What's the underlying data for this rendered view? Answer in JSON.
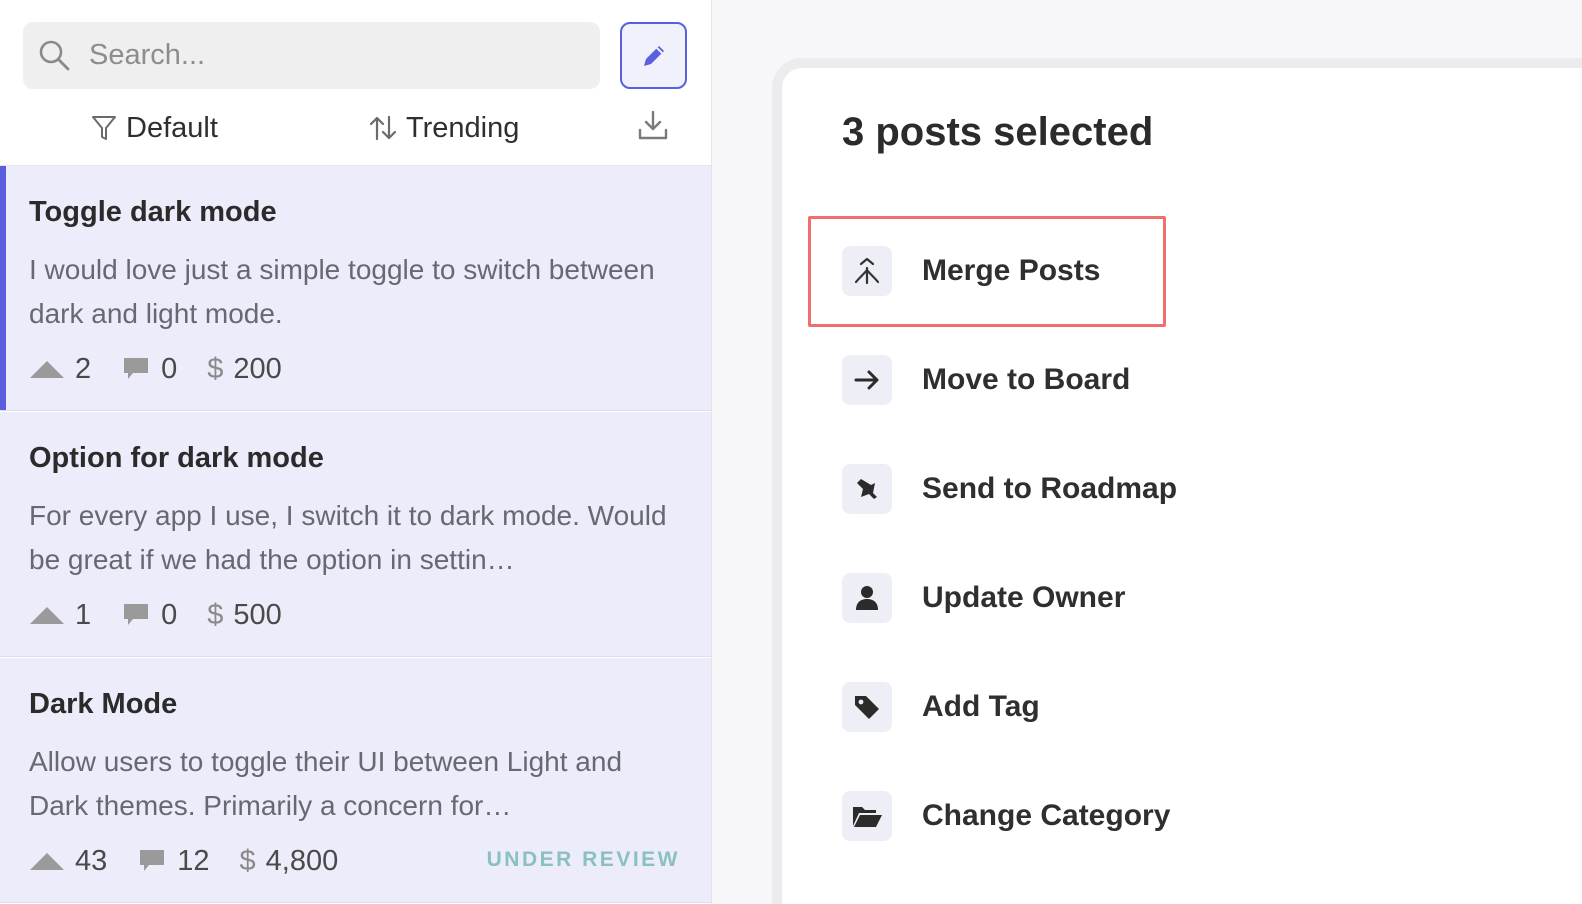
{
  "search": {
    "placeholder": "Search..."
  },
  "filters": {
    "default_label": "Default",
    "trending_label": "Trending"
  },
  "posts": [
    {
      "title": "Toggle dark mode",
      "body": "I would love just a simple toggle to switch between dark and light mode.",
      "votes": "2",
      "comments": "0",
      "currency": "$",
      "value": "200",
      "status": "",
      "selected": true
    },
    {
      "title": "Option for dark mode",
      "body": "For every app I use, I switch it to dark mode. Would be great if we had the option in settin…",
      "votes": "1",
      "comments": "0",
      "currency": "$",
      "value": "500",
      "status": "",
      "selected": false
    },
    {
      "title": "Dark Mode",
      "body": "Allow users to toggle their UI between Light and Dark themes. Primarily a concern for…",
      "votes": "43",
      "comments": "12",
      "currency": "$",
      "value": "4,800",
      "status": "UNDER REVIEW",
      "selected": false
    }
  ],
  "panel": {
    "title": "3 posts selected",
    "actions": [
      {
        "label": "Merge Posts",
        "icon": "merge-icon"
      },
      {
        "label": "Move to Board",
        "icon": "arrow-right-icon"
      },
      {
        "label": "Send to Roadmap",
        "icon": "pin-icon"
      },
      {
        "label": "Update Owner",
        "icon": "user-icon"
      },
      {
        "label": "Add Tag",
        "icon": "tag-icon"
      },
      {
        "label": "Change Category",
        "icon": "folder-open-icon"
      }
    ]
  },
  "colors": {
    "accent": "#5a5ee0",
    "post_background": "#ececfb",
    "highlight": "#ef6e6e",
    "status_under_review": "#8bc0c2"
  }
}
